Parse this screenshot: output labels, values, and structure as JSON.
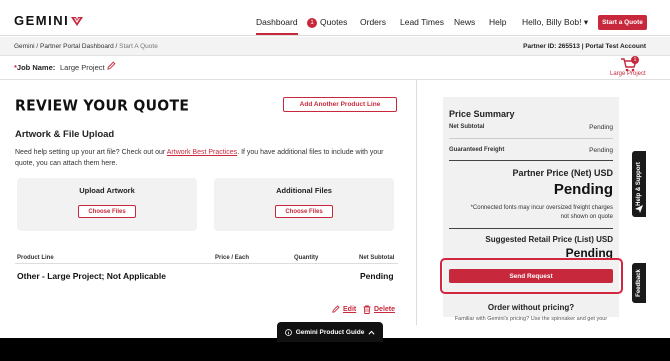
{
  "brand": {
    "name": "GEMINI",
    "accent": "#c8283b"
  },
  "nav": {
    "dashboard": "Dashboard",
    "quotes": "Quotes",
    "quotes_badge": "1",
    "orders": "Orders",
    "lead_times": "Lead Times",
    "news": "News",
    "help": "Help",
    "user_menu": "Hello, Billy Bob! ▾",
    "start_quote": "Start a Quote"
  },
  "breadcrumb": {
    "home": "Gemini",
    "sep1": " / ",
    "partner_portal": "Partner Portal Dashboard",
    "sep2": " / ",
    "current": "Start A Quote"
  },
  "partner_info": "Partner ID: 265513 | Portal Test Account",
  "job": {
    "required_mark": "*",
    "label": "Job Name:",
    "value": "Large Project"
  },
  "cart": {
    "count": "1",
    "label": "Large Project"
  },
  "review": {
    "title": "REVIEW YOUR QUOTE",
    "add_line": "Add Another Product Line"
  },
  "artwork": {
    "heading": "Artwork & File Upload",
    "desc_before": "Need help setting up your art file? Check out our ",
    "desc_link": "Artwork Best Practices",
    "desc_after": ". If you have additional files to include with your quote, you can attach them here.",
    "upload_title": "Upload Artwork",
    "additional_title": "Additional Files",
    "choose_files": "Choose Files"
  },
  "table": {
    "headers": {
      "product_line": "Product Line",
      "price_each": "Price / Each",
      "quantity": "Quantity",
      "net_subtotal": "Net Subtotal"
    },
    "rows": [
      {
        "name": "Other - Large Project; Not Applicable",
        "net_subtotal": "Pending"
      }
    ],
    "edit": "Edit",
    "delete": "Delete"
  },
  "summary": {
    "title": "Price Summary",
    "net_subtotal_label": "Net Subtotal",
    "net_subtotal_value": "Pending",
    "freight_label": "Guaranteed Freight",
    "freight_value": "Pending",
    "partner_price_label": "Partner Price (Net) USD",
    "partner_price_value": "Pending",
    "note": "*Connected fonts may incur oversized freight charges not shown on quote",
    "retail_label": "Suggested Retail Price (List) USD",
    "retail_value": "Pending",
    "send_request": "Send Request",
    "order_without": "Order without pricing?",
    "order_sub": "Familiar with Gemini's pricing? Use the spinnaker and get your"
  },
  "side_tabs": {
    "help": "Help & Support",
    "feedback": "Feedback"
  },
  "footer": {
    "guide": "Gemini Product Guide"
  }
}
